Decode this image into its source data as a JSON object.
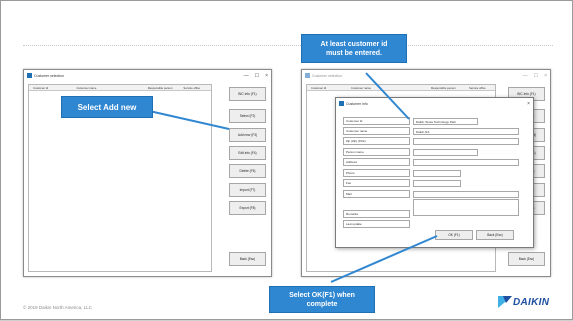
{
  "left_window": {
    "title": "Customer selection",
    "controls": [
      "—",
      "☐",
      "×"
    ],
    "columns": [
      "Customer Id",
      "Customer name",
      "Responsible person",
      "Service office"
    ],
    "buttons": [
      "BIC Info (F1)",
      "Select (F2)",
      "Add new (F3)",
      "Edit info (F4)",
      "Delete (F5)",
      "Import (F7)",
      "Export (F8)",
      "Back (Esc)"
    ]
  },
  "right_window": {
    "title": "Customer selection",
    "controls": [
      "—",
      "☐",
      "×"
    ],
    "columns": [
      "Customer Id",
      "Customer name",
      "Responsible person",
      "Service office"
    ],
    "buttons": [
      "BIC Info (F1)",
      "Select (F2)",
      "Add new (F3)",
      "Edit info (F4)",
      "Delete (F5)",
      "Import (F7)",
      "Export (F8)",
      "Back (Esc)"
    ]
  },
  "dialog": {
    "title": "Customer info",
    "close": "×",
    "fields": [
      {
        "label": "Customer Id",
        "value": "Daikin Texas Technology Park"
      },
      {
        "label": "Customer name",
        "value": "Daikin NA"
      },
      {
        "label": "Zip (Zip) (Pick)",
        "value": ""
      },
      {
        "label": "Person name",
        "value": ""
      },
      {
        "label": "Address",
        "value": ""
      },
      {
        "label": "Phone",
        "value": ""
      },
      {
        "label": "Fax",
        "value": ""
      },
      {
        "label": "Mail",
        "value": ""
      },
      {
        "label": "Remarks",
        "value": ""
      },
      {
        "label": "Last update",
        "value": ""
      }
    ],
    "ok_label": "OK (F1)",
    "back_label": "Back (Esc)"
  },
  "callouts": {
    "select_add_new": "Select Add new",
    "customer_id": [
      "At least customer id",
      "must be entered."
    ],
    "select_ok": [
      "Select OK(F1) when",
      "complete"
    ]
  },
  "footer": "© 2019 Daikin North America, LLC",
  "logo_text": "DAIKIN",
  "colors": {
    "callout_blue": "#2f86d1",
    "brand_blue": "#1f4fa0",
    "logo_accent": "#3fb0e6"
  }
}
